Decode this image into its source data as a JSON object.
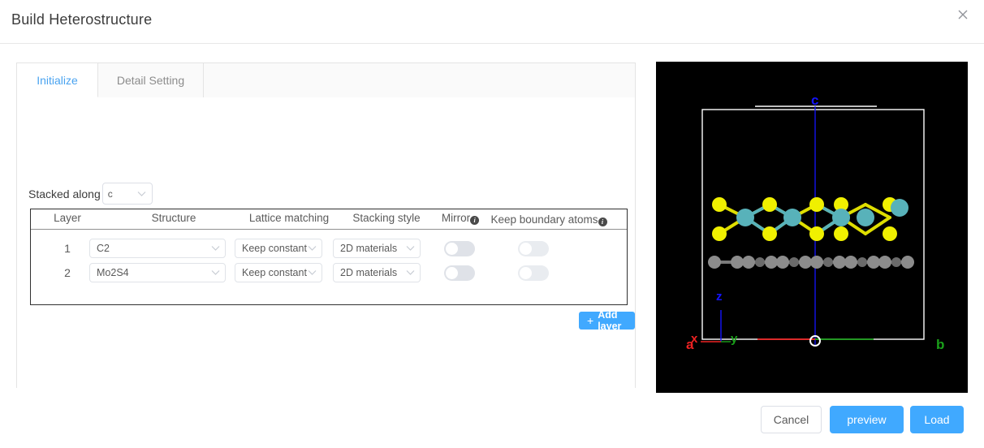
{
  "dialog": {
    "title": "Build Heterostructure",
    "close_icon": "close-icon"
  },
  "tabs": [
    {
      "label": "Initialize",
      "active": true
    },
    {
      "label": "Detail Setting",
      "active": false
    }
  ],
  "stacked_along": {
    "label": "Stacked along",
    "value": "c",
    "caret_icon": "chevron-down-icon"
  },
  "table": {
    "headers": {
      "layer": "Layer",
      "structure": "Structure",
      "lattice_matching": "Lattice matching",
      "stacking_style": "Stacking style",
      "mirror": "Mirror",
      "keep_boundary_atoms": "Keep boundary atoms"
    },
    "rows": [
      {
        "layer": "1",
        "structure": "C2",
        "lattice_matching": "Keep constant",
        "stacking_style": "2D materials",
        "mirror": false,
        "keep_boundary_atoms": false
      },
      {
        "layer": "2",
        "structure": "Mo2S4",
        "lattice_matching": "Keep constant",
        "stacking_style": "2D materials",
        "mirror": false,
        "keep_boundary_atoms": false
      }
    ]
  },
  "add_layer": {
    "label": "Add layer",
    "plus": "+"
  },
  "viewer": {
    "background": "#000000",
    "axis_labels": {
      "a": "a",
      "b": "b",
      "c": "c",
      "x": "x",
      "y": "y",
      "z": "z",
      "origin": "o"
    },
    "axis_colors": {
      "a": "#ee2222",
      "b": "#1aa01a",
      "c": "#1414ff",
      "x": "#ee2222",
      "y": "#1aa01a",
      "z": "#1414ff",
      "origin": "#ffffff",
      "cell_box": "#ffffff"
    },
    "atom_colors": {
      "sulfur": "#f0f000",
      "molybdenum": "#58b2ba",
      "carbon": "#8c8c8c",
      "bond_s_mo": "#dede00",
      "bond_c": "#7a7a7a"
    }
  },
  "footer": {
    "cancel": "Cancel",
    "preview": "preview",
    "load": "Load"
  },
  "colors": {
    "accent": "#40a9ff",
    "tab_active_text": "#4aa3f0",
    "text": "#3c3c3c",
    "muted": "#8c8c8c"
  }
}
